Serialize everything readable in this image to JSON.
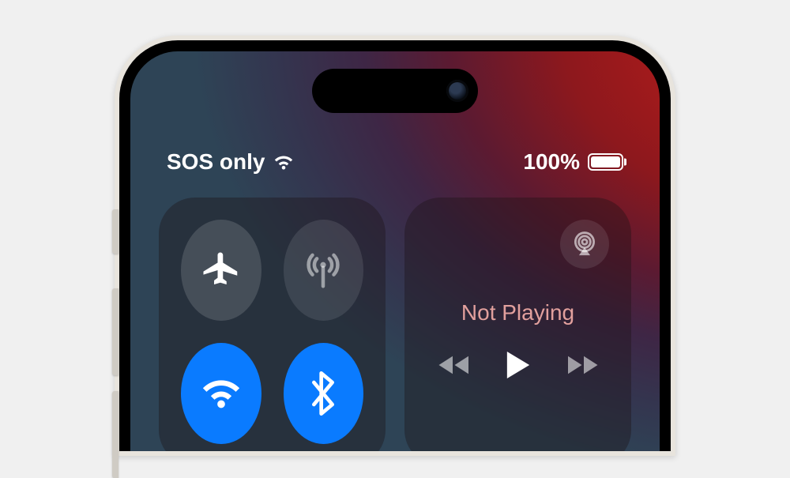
{
  "status": {
    "carrier": "SOS only",
    "battery_pct": "100%"
  },
  "connectivity": {
    "airplane": {
      "name": "airplane-mode",
      "active": false
    },
    "cellular": {
      "name": "cellular-data",
      "active": false
    },
    "wifi": {
      "name": "wifi",
      "active": true
    },
    "bluetooth": {
      "name": "bluetooth",
      "active": true
    }
  },
  "media": {
    "now_playing": "Not Playing"
  },
  "colors": {
    "accent_blue": "#0a7bff"
  }
}
